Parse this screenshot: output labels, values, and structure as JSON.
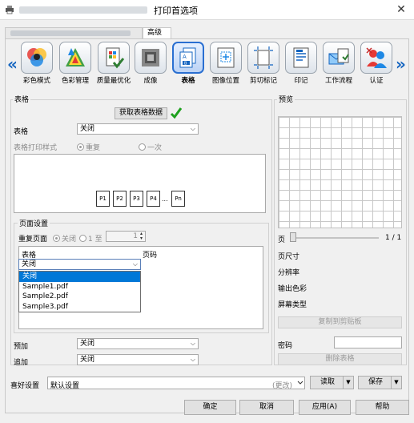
{
  "window": {
    "title": "打印首选项",
    "close_glyph": "✕"
  },
  "tabs": {
    "advanced": "高级"
  },
  "nav": {
    "prev_arrow": "«",
    "next_arrow": "»",
    "items": [
      {
        "label": "彩色模式",
        "icon": "color-mode-icon"
      },
      {
        "label": "色彩管理",
        "icon": "color-management-icon"
      },
      {
        "label": "质量最优化",
        "icon": "quality-optimize-icon"
      },
      {
        "label": "成像",
        "icon": "imaging-icon"
      },
      {
        "label": "表格",
        "icon": "form-icon",
        "selected": true
      },
      {
        "label": "图像位置",
        "icon": "image-position-icon"
      },
      {
        "label": "剪切标记",
        "icon": "crop-marks-icon"
      },
      {
        "label": "印记",
        "icon": "stamp-icon"
      },
      {
        "label": "工作流程",
        "icon": "workflow-icon"
      },
      {
        "label": "认证",
        "icon": "authentication-icon"
      }
    ]
  },
  "form": {
    "section_title": "表格",
    "get_form_data_button": "获取表格数据",
    "form_label": "表格",
    "form_value": "关闭",
    "print_style_label": "表格打印样式",
    "style_repeat": "重复",
    "style_once": "一次",
    "preview_pages": [
      "P1",
      "P2",
      "P3",
      "P4",
      "...",
      "Pn"
    ],
    "page_settings": {
      "title": "页面设置",
      "repeat_page_label": "重复页面",
      "off": "关闭",
      "one": "1",
      "to": "至",
      "range_value": "1",
      "col_form": "表格",
      "col_page": "页码",
      "select_value": "关闭",
      "options": [
        "关闭",
        "Sample1.pdf",
        "Sample2.pdf",
        "Sample3.pdf"
      ]
    },
    "preadd_label": "预加",
    "preadd_value": "关闭",
    "append_label": "追加",
    "append_value": "关闭"
  },
  "preview": {
    "title": "预览",
    "page_label": "页",
    "page_count": "1 / 1",
    "page_size_label": "页尺寸",
    "resolution_label": "分辨率",
    "output_color_label": "输出色彩",
    "screen_type_label": "屏幕类型",
    "copy_clipboard_button": "复制到剪贴板",
    "password_label": "密码",
    "password_value": "",
    "delete_form_button": "删除表格"
  },
  "favorites": {
    "label": "喜好设置",
    "value": "默认设置",
    "changed": "(更改)",
    "read_button": "读取",
    "save_button": "保存"
  },
  "footer": {
    "ok": "确定",
    "cancel": "取消",
    "apply": "应用(A)",
    "help": "帮助"
  }
}
